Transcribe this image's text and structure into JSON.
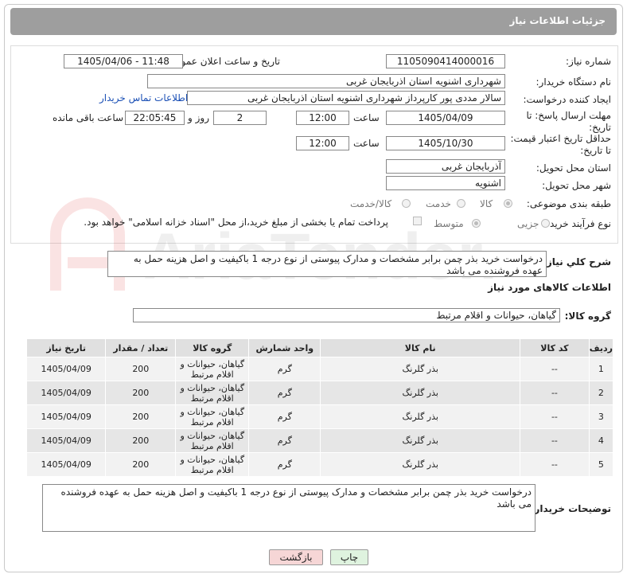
{
  "header": {
    "title": "جزئیات اطلاعات نیاز"
  },
  "fields": {
    "need_number_label": "شماره نیاز:",
    "need_number": "1105090414000016",
    "announce_label": "تاریخ و ساعت اعلان عمومی:",
    "announce_value": "1405/04/06 - 11:48",
    "buyer_org_label": "نام دستگاه خریدار:",
    "buyer_org": "شهرداری اشنویه استان اذربایجان غربی",
    "creator_label": "ایجاد کننده درخواست:",
    "creator": "سالار مددی پور کارپرداز شهرداری اشنویه استان اذربایجان غربی",
    "contact_link": "اطلاعات تماس خریدار",
    "deadline_label": "مهلت ارسال پاسخ: تا تاریخ:",
    "deadline_date": "1405/04/09",
    "time_label": "ساعت",
    "deadline_time": "12:00",
    "days_value": "2",
    "days_label": "روز و",
    "remaining_time": "22:05:45",
    "remaining_label": "ساعت باقی مانده",
    "price_validity_label": "حداقل تاریخ اعتبار قیمت: تا تاریخ:",
    "price_validity_date": "1405/10/30",
    "price_validity_time": "12:00",
    "province_label": "استان محل تحویل:",
    "province": "آذربایجان غربی",
    "city_label": "شهر محل تحویل:",
    "city": "اشنویه",
    "category_label": "طبقه بندی موضوعی:",
    "category_options": [
      "کالا",
      "خدمت",
      "کالا/خدمت"
    ],
    "process_label": "نوع فرآیند خرید :",
    "process_options": [
      "جزیی",
      "متوسط"
    ],
    "payment_note": "پرداخت تمام یا بخشی از مبلغ خرید،از محل \"اسناد خزانه اسلامی\" خواهد بود."
  },
  "summary": {
    "label": "شرح کلي نياز:",
    "text": "درخواست خرید بذر چمن برابر مشخصات و مدارک پیوستی از نوع درجه 1 باکیفیت و اصل هزینه حمل به عهده فروشنده می باشد"
  },
  "goods": {
    "section_title": "اطلاعات کالاهای مورد نیاز",
    "group_label": "گروه کالا:",
    "group_value": "گیاهان، حیوانات و اقلام مرتبط",
    "columns": [
      "ردیف",
      "کد کالا",
      "نام کالا",
      "واحد شمارش",
      "گروه کالا",
      "تعداد / مقدار",
      "تاریخ نیاز"
    ],
    "rows": [
      {
        "idx": "1",
        "code": "--",
        "name": "بذر گلرنگ",
        "unit": "گرم",
        "group": "گیاهان، حیوانات و اقلام مرتبط",
        "qty": "200",
        "date": "1405/04/09"
      },
      {
        "idx": "2",
        "code": "--",
        "name": "بذر گلرنگ",
        "unit": "گرم",
        "group": "گیاهان، حیوانات و اقلام مرتبط",
        "qty": "200",
        "date": "1405/04/09"
      },
      {
        "idx": "3",
        "code": "--",
        "name": "بذر گلرنگ",
        "unit": "گرم",
        "group": "گیاهان، حیوانات و اقلام مرتبط",
        "qty": "200",
        "date": "1405/04/09"
      },
      {
        "idx": "4",
        "code": "--",
        "name": "بذر گلرنگ",
        "unit": "گرم",
        "group": "گیاهان، حیوانات و اقلام مرتبط",
        "qty": "200",
        "date": "1405/04/09"
      },
      {
        "idx": "5",
        "code": "--",
        "name": "بذر گلرنگ",
        "unit": "گرم",
        "group": "گیاهان، حیوانات و اقلام مرتبط",
        "qty": "200",
        "date": "1405/04/09"
      }
    ]
  },
  "buyer_notes": {
    "label": "توضیحات خریدار:",
    "text": "درخواست خرید بذر چمن برابر مشخصات و مدارک پیوستی از نوع درجه 1 باکیفیت و اصل هزینه حمل به عهده فروشنده می باشد"
  },
  "buttons": {
    "print": "چاپ",
    "back": "بازگشت"
  },
  "watermark": {
    "text": "AriaTender.net"
  },
  "colors": {
    "title_bar": "#9e9e9e",
    "print_bg": "#dff3df",
    "back_bg": "#f6d6d6",
    "link": "#1a4fb5"
  }
}
